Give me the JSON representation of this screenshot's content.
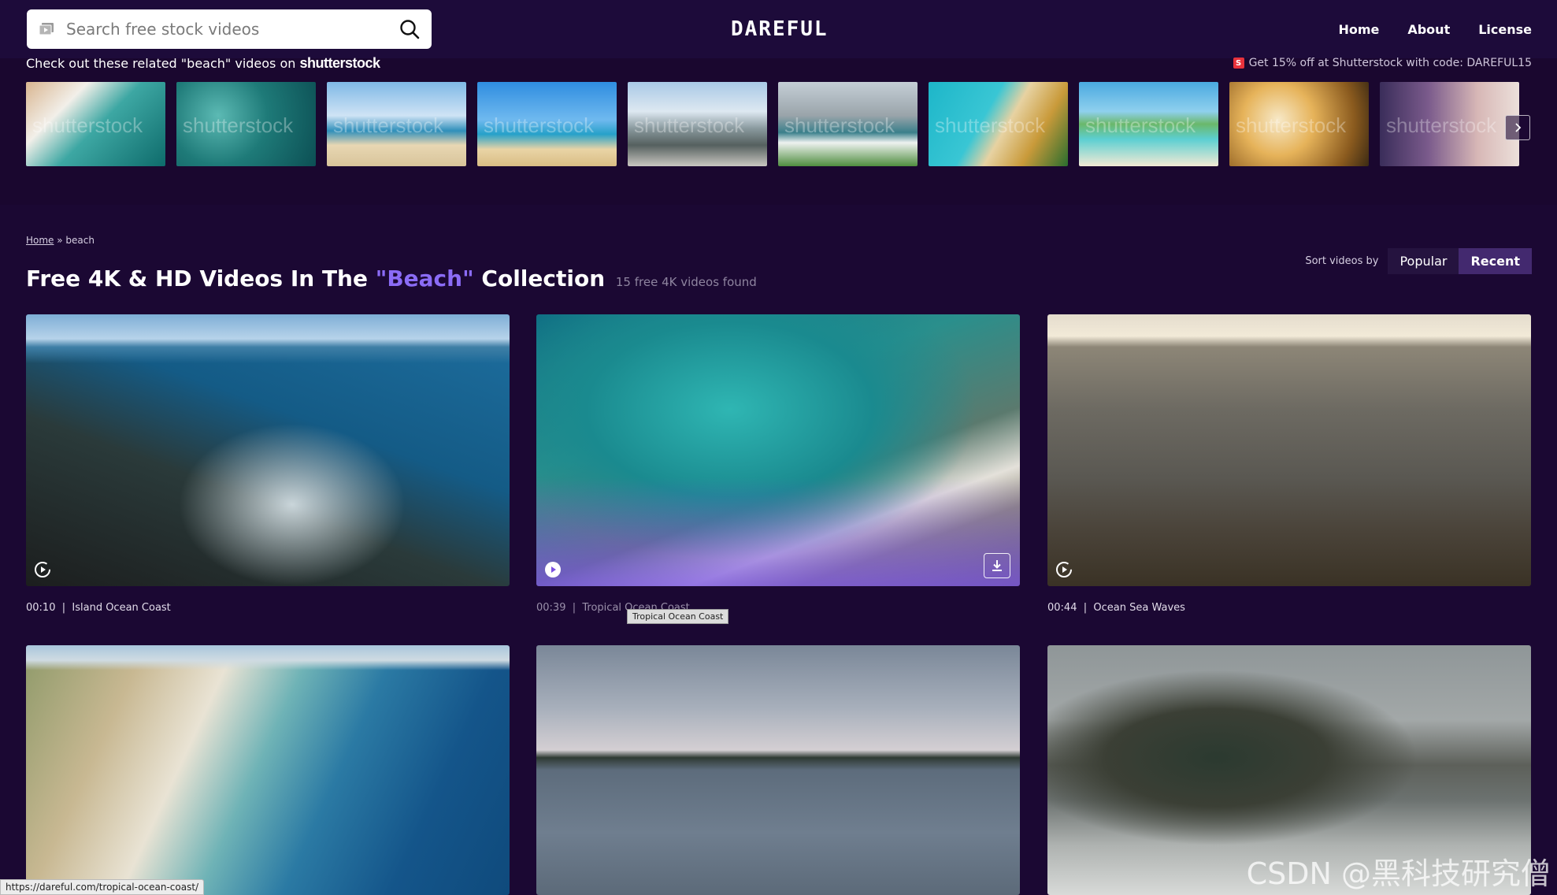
{
  "search": {
    "placeholder": "Search free stock videos"
  },
  "logo": "DAREFUL",
  "nav": {
    "home": "Home",
    "about": "About",
    "license": "License"
  },
  "related": {
    "heading": "Check out these related \"beach\" videos on ",
    "brand": "shutterstock",
    "promo": "Get 15% off at Shutterstock with code: DAREFUL15",
    "watermark": "shutterstock"
  },
  "breadcrumb": {
    "home": "Home",
    "separator": " » ",
    "current": "beach"
  },
  "title": {
    "prefix": "Free 4K & HD Videos In The ",
    "collection": "\"Beach\"",
    "suffix": " Collection",
    "count": "15 free 4K videos found"
  },
  "sort": {
    "label": "Sort videos by",
    "options": [
      "Popular",
      "Recent"
    ],
    "active": "Recent"
  },
  "videos": [
    {
      "duration": "00:10",
      "title": "Island Ocean Coast"
    },
    {
      "duration": "00:39",
      "title": "Tropical Ocean Coast"
    },
    {
      "duration": "00:44",
      "title": "Ocean Sea Waves"
    },
    {
      "duration": "",
      "title": ""
    },
    {
      "duration": "",
      "title": ""
    },
    {
      "duration": "",
      "title": ""
    }
  ],
  "tooltip": "Tropical Ocean Coast",
  "status_url": "https://dareful.com/tropical-ocean-coast/",
  "screen_watermark": "CSDN @黑科技研究僧",
  "colors": {
    "background": "#1b0833",
    "accent": "#8b6cf6",
    "sort_active": "#43296f"
  }
}
